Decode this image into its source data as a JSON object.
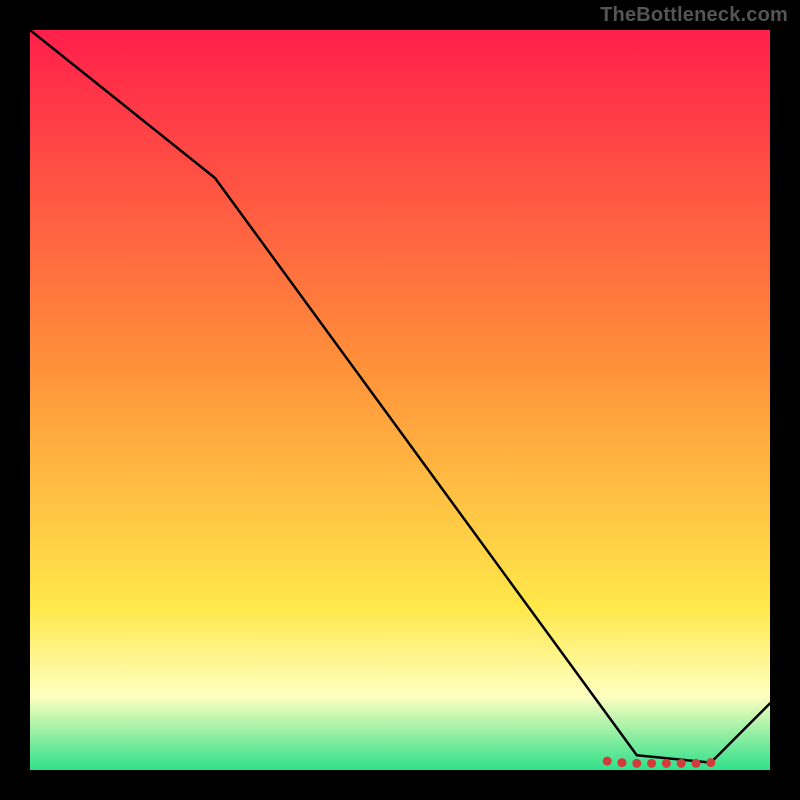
{
  "watermark": "TheBottleneck.com",
  "colors": {
    "gradient_top": "#ff1f4b",
    "gradient_mid1": "#ff903a",
    "gradient_mid2": "#ffe84a",
    "gradient_band": "#ffffc0",
    "gradient_bottom": "#2fe08a",
    "line": "#000000",
    "dot": "#d33a3a"
  },
  "chart_data": {
    "type": "line",
    "title": "",
    "xlabel": "",
    "ylabel": "",
    "xlim": [
      0,
      100
    ],
    "ylim": [
      0,
      100
    ],
    "x": [
      0,
      25,
      82,
      92,
      100
    ],
    "values": [
      100,
      80,
      2,
      1,
      9
    ],
    "dots_x": [
      78,
      80,
      82,
      84,
      86,
      88,
      90,
      92
    ],
    "dots_y": [
      1.2,
      1.0,
      0.9,
      0.9,
      0.9,
      0.9,
      0.9,
      1.0
    ]
  }
}
